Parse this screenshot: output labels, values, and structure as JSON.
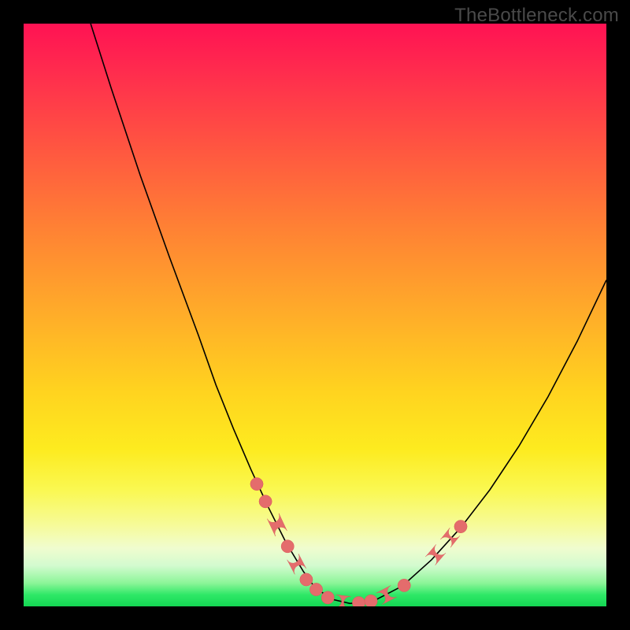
{
  "watermark": "TheBottleneck.com",
  "colors": {
    "background": "#000000",
    "gradient_stops": [
      "#ff1253",
      "#ff2b4e",
      "#ff5840",
      "#ff8433",
      "#ffad29",
      "#ffd31f",
      "#fdeb1f",
      "#faf851",
      "#f6fb98",
      "#f0fccf",
      "#d3fbcf",
      "#8cf598",
      "#2fe867",
      "#14d753"
    ],
    "curve": "#000000",
    "marker": "#e46c6c"
  },
  "chart_data": {
    "type": "line",
    "title": "",
    "xlabel": "",
    "ylabel": "",
    "xlim": [
      0,
      100
    ],
    "ylim": [
      0,
      100
    ],
    "series": [
      {
        "name": "curve",
        "x": [
          11.5,
          15,
          20,
          25,
          30,
          33,
          36,
          39,
          42,
          45,
          48,
          50,
          53,
          56,
          60,
          65,
          70,
          75,
          80,
          85,
          90,
          95,
          100
        ],
        "y": [
          100,
          89,
          74,
          60,
          46.5,
          38,
          30.5,
          23.5,
          17,
          11,
          6,
          3.2,
          1.2,
          0.5,
          0.9,
          3.5,
          8,
          13.5,
          20,
          27.5,
          36,
          45.5,
          56
        ]
      }
    ],
    "markers": [
      {
        "type": "dot",
        "x": 40.0,
        "y": 21.0
      },
      {
        "type": "dot",
        "x": 41.5,
        "y": 18.0
      },
      {
        "type": "pill",
        "x1": 42.8,
        "y1": 15.5,
        "x2": 44.2,
        "y2": 12.5
      },
      {
        "type": "dot",
        "x": 45.3,
        "y": 10.3
      },
      {
        "type": "pill",
        "x1": 46.2,
        "y1": 8.5,
        "x2": 47.5,
        "y2": 6.0
      },
      {
        "type": "dot",
        "x": 48.5,
        "y": 4.6
      },
      {
        "type": "dot",
        "x": 50.2,
        "y": 2.9
      },
      {
        "type": "dot",
        "x": 52.2,
        "y": 1.5
      },
      {
        "type": "pill",
        "x1": 53.5,
        "y1": 0.9,
        "x2": 56.0,
        "y2": 0.6
      },
      {
        "type": "dot",
        "x": 57.5,
        "y": 0.6
      },
      {
        "type": "dot",
        "x": 59.6,
        "y": 0.9
      },
      {
        "type": "pill",
        "x1": 61.0,
        "y1": 1.3,
        "x2": 63.5,
        "y2": 2.6
      },
      {
        "type": "dot",
        "x": 65.3,
        "y": 3.6
      },
      {
        "type": "pill",
        "x1": 69.8,
        "y1": 7.8,
        "x2": 71.6,
        "y2": 9.9
      },
      {
        "type": "pill",
        "x1": 72.4,
        "y1": 10.8,
        "x2": 74.0,
        "y2": 12.8
      },
      {
        "type": "dot",
        "x": 75.0,
        "y": 13.7
      }
    ],
    "marker_radius": 1.1
  }
}
